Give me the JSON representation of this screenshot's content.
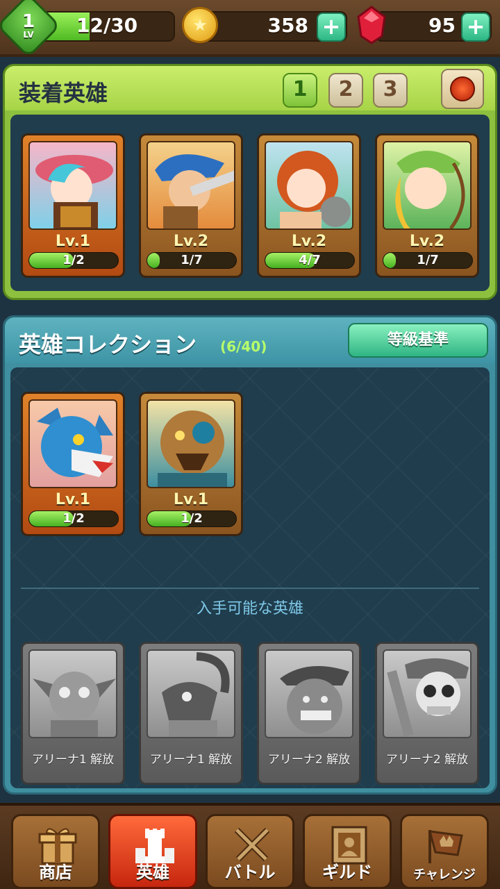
{
  "player": {
    "level": "1",
    "level_label": "LV",
    "xp_text": "12/30",
    "xp_progress": 0.4
  },
  "resources": {
    "gold": "358",
    "gems": "95",
    "plus": "+"
  },
  "equipped": {
    "title": "装着英雄",
    "team_tabs": [
      "1",
      "2",
      "3"
    ],
    "active_team": "1",
    "heroes": [
      {
        "level": "Lv.1",
        "progress": "1/2",
        "fill": 0.5,
        "frame": "orange"
      },
      {
        "level": "Lv.2",
        "progress": "1/7",
        "fill": 0.14,
        "frame": "brown"
      },
      {
        "level": "Lv.2",
        "progress": "4/7",
        "fill": 0.57,
        "frame": "brown"
      },
      {
        "level": "Lv.2",
        "progress": "1/7",
        "fill": 0.14,
        "frame": "brown"
      }
    ]
  },
  "collection": {
    "title": "英雄コレクション",
    "count": "(6/40)",
    "grade_button": "等級基準",
    "owned": [
      {
        "level": "Lv.1",
        "progress": "1/2",
        "fill": 0.5,
        "frame": "orange"
      },
      {
        "level": "Lv.1",
        "progress": "1/2",
        "fill": 0.5,
        "frame": "brown"
      }
    ],
    "available_label": "入手可能な英雄",
    "locked": [
      {
        "unlock": "アリーナ1 解放"
      },
      {
        "unlock": "アリーナ1 解放"
      },
      {
        "unlock": "アリーナ2 解放"
      },
      {
        "unlock": "アリーナ2 解放"
      }
    ]
  },
  "nav": {
    "items": [
      {
        "label": "商店",
        "icon": "gift-icon"
      },
      {
        "label": "英雄",
        "icon": "chess-rook-icon"
      },
      {
        "label": "バトル",
        "icon": "crossed-swords-icon"
      },
      {
        "label": "ギルド",
        "icon": "guild-portrait-icon"
      },
      {
        "label": "チャレンジ",
        "icon": "flag-crown-icon"
      }
    ],
    "active": "英雄"
  },
  "colors": {
    "accent_green": "#8dc03e",
    "accent_teal": "#3f8fa0",
    "active_nav": "#c6260e",
    "count_green": "#b7ff6a"
  }
}
